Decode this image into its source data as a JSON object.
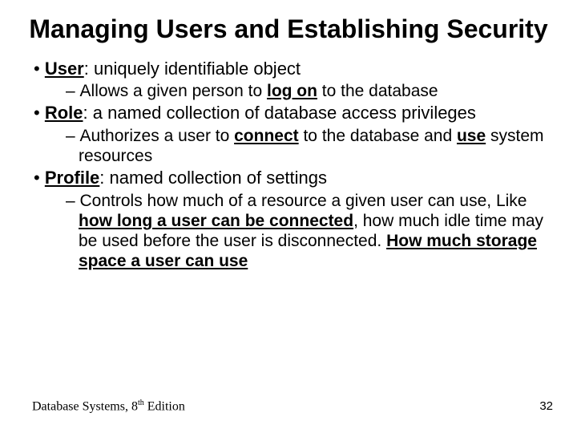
{
  "title": "Managing Users and Establishing Security",
  "b1_label": "User",
  "b1_rest": ": uniquely identifiable object",
  "b1s_pre": "Allows a given person to ",
  "b1s_em": "log on",
  "b1s_post": " to the database",
  "b2_label": "Role",
  "b2_rest": ": a named collection of database access privileges",
  "b2s_pre": "Authorizes a user to ",
  "b2s_em1": "connect",
  "b2s_mid": " to the database and ",
  "b2s_em2": "use",
  "b2s_post": " system resources",
  "b3_label": "Profile",
  "b3_rest": ": named collection of settings",
  "b3s_pre": "Controls how much of a resource a given user can use, Like ",
  "b3s_em1": "how long a user can be connected",
  "b3s_mid": ", how much idle time may be used before the user is disconnected. ",
  "b3s_em2": "How much storage space a user can use",
  "footer_pre": "Database Systems, 8",
  "footer_sup": "th",
  "footer_post": " Edition",
  "page": "32"
}
